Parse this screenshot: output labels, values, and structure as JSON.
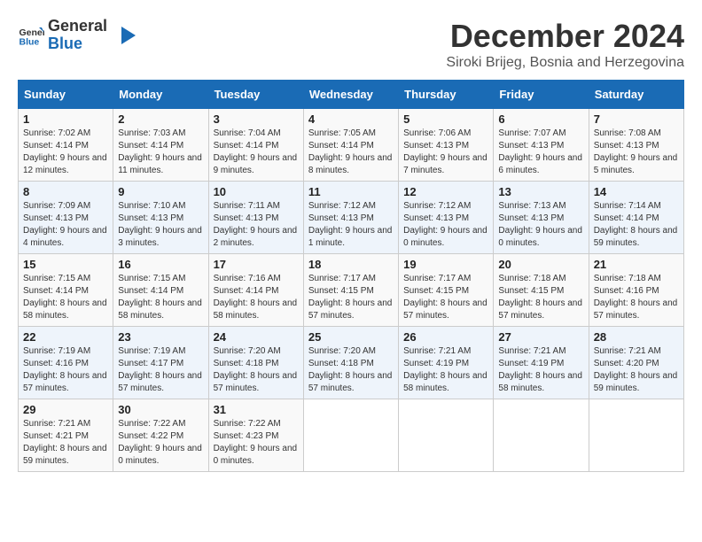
{
  "logo": {
    "text_general": "General",
    "text_blue": "Blue"
  },
  "title": "December 2024",
  "location": "Siroki Brijeg, Bosnia and Herzegovina",
  "weekdays": [
    "Sunday",
    "Monday",
    "Tuesday",
    "Wednesday",
    "Thursday",
    "Friday",
    "Saturday"
  ],
  "weeks": [
    [
      {
        "day": "1",
        "sunrise": "7:02 AM",
        "sunset": "4:14 PM",
        "daylight": "9 hours and 12 minutes."
      },
      {
        "day": "2",
        "sunrise": "7:03 AM",
        "sunset": "4:14 PM",
        "daylight": "9 hours and 11 minutes."
      },
      {
        "day": "3",
        "sunrise": "7:04 AM",
        "sunset": "4:14 PM",
        "daylight": "9 hours and 9 minutes."
      },
      {
        "day": "4",
        "sunrise": "7:05 AM",
        "sunset": "4:14 PM",
        "daylight": "9 hours and 8 minutes."
      },
      {
        "day": "5",
        "sunrise": "7:06 AM",
        "sunset": "4:13 PM",
        "daylight": "9 hours and 7 minutes."
      },
      {
        "day": "6",
        "sunrise": "7:07 AM",
        "sunset": "4:13 PM",
        "daylight": "9 hours and 6 minutes."
      },
      {
        "day": "7",
        "sunrise": "7:08 AM",
        "sunset": "4:13 PM",
        "daylight": "9 hours and 5 minutes."
      }
    ],
    [
      {
        "day": "8",
        "sunrise": "7:09 AM",
        "sunset": "4:13 PM",
        "daylight": "9 hours and 4 minutes."
      },
      {
        "day": "9",
        "sunrise": "7:10 AM",
        "sunset": "4:13 PM",
        "daylight": "9 hours and 3 minutes."
      },
      {
        "day": "10",
        "sunrise": "7:11 AM",
        "sunset": "4:13 PM",
        "daylight": "9 hours and 2 minutes."
      },
      {
        "day": "11",
        "sunrise": "7:12 AM",
        "sunset": "4:13 PM",
        "daylight": "9 hours and 1 minute."
      },
      {
        "day": "12",
        "sunrise": "7:12 AM",
        "sunset": "4:13 PM",
        "daylight": "9 hours and 0 minutes."
      },
      {
        "day": "13",
        "sunrise": "7:13 AM",
        "sunset": "4:13 PM",
        "daylight": "9 hours and 0 minutes."
      },
      {
        "day": "14",
        "sunrise": "7:14 AM",
        "sunset": "4:14 PM",
        "daylight": "8 hours and 59 minutes."
      }
    ],
    [
      {
        "day": "15",
        "sunrise": "7:15 AM",
        "sunset": "4:14 PM",
        "daylight": "8 hours and 58 minutes."
      },
      {
        "day": "16",
        "sunrise": "7:15 AM",
        "sunset": "4:14 PM",
        "daylight": "8 hours and 58 minutes."
      },
      {
        "day": "17",
        "sunrise": "7:16 AM",
        "sunset": "4:14 PM",
        "daylight": "8 hours and 58 minutes."
      },
      {
        "day": "18",
        "sunrise": "7:17 AM",
        "sunset": "4:15 PM",
        "daylight": "8 hours and 57 minutes."
      },
      {
        "day": "19",
        "sunrise": "7:17 AM",
        "sunset": "4:15 PM",
        "daylight": "8 hours and 57 minutes."
      },
      {
        "day": "20",
        "sunrise": "7:18 AM",
        "sunset": "4:15 PM",
        "daylight": "8 hours and 57 minutes."
      },
      {
        "day": "21",
        "sunrise": "7:18 AM",
        "sunset": "4:16 PM",
        "daylight": "8 hours and 57 minutes."
      }
    ],
    [
      {
        "day": "22",
        "sunrise": "7:19 AM",
        "sunset": "4:16 PM",
        "daylight": "8 hours and 57 minutes."
      },
      {
        "day": "23",
        "sunrise": "7:19 AM",
        "sunset": "4:17 PM",
        "daylight": "8 hours and 57 minutes."
      },
      {
        "day": "24",
        "sunrise": "7:20 AM",
        "sunset": "4:18 PM",
        "daylight": "8 hours and 57 minutes."
      },
      {
        "day": "25",
        "sunrise": "7:20 AM",
        "sunset": "4:18 PM",
        "daylight": "8 hours and 57 minutes."
      },
      {
        "day": "26",
        "sunrise": "7:21 AM",
        "sunset": "4:19 PM",
        "daylight": "8 hours and 58 minutes."
      },
      {
        "day": "27",
        "sunrise": "7:21 AM",
        "sunset": "4:19 PM",
        "daylight": "8 hours and 58 minutes."
      },
      {
        "day": "28",
        "sunrise": "7:21 AM",
        "sunset": "4:20 PM",
        "daylight": "8 hours and 59 minutes."
      }
    ],
    [
      {
        "day": "29",
        "sunrise": "7:21 AM",
        "sunset": "4:21 PM",
        "daylight": "8 hours and 59 minutes."
      },
      {
        "day": "30",
        "sunrise": "7:22 AM",
        "sunset": "4:22 PM",
        "daylight": "9 hours and 0 minutes."
      },
      {
        "day": "31",
        "sunrise": "7:22 AM",
        "sunset": "4:23 PM",
        "daylight": "9 hours and 0 minutes."
      },
      null,
      null,
      null,
      null
    ]
  ],
  "labels": {
    "sunrise": "Sunrise:",
    "sunset": "Sunset:",
    "daylight": "Daylight:"
  }
}
